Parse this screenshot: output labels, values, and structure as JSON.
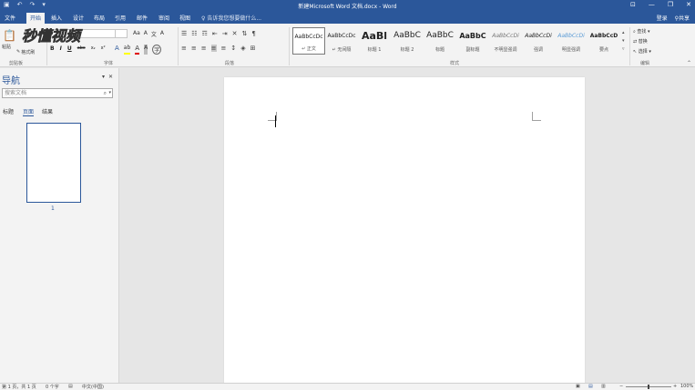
{
  "window": {
    "title": "新建Microsoft Word 文档.docx - Word",
    "qat_icons": [
      "save-icon",
      "undo-icon",
      "redo-icon",
      "customize-icon"
    ],
    "controls": [
      "ribbon-display-icon",
      "minimize-icon",
      "restore-icon",
      "close-icon"
    ]
  },
  "tabs": {
    "items": [
      "文件",
      "开始",
      "插入",
      "设计",
      "布局",
      "引用",
      "邮件",
      "审阅",
      "视图"
    ],
    "active": "开始",
    "tellme": "告诉我您想要做什么...",
    "login": "登录",
    "share": "共享"
  },
  "ribbon": {
    "clipboard": {
      "paste": "粘贴",
      "format_painter": "格式刷",
      "label": "剪贴板"
    },
    "font": {
      "label": "字体",
      "font_name": "",
      "font_size": "",
      "bold": "B",
      "italic": "I",
      "underline": "U",
      "strike": "abc",
      "subscript": "x₂",
      "superscript": "x²",
      "grow": "A",
      "shrink": "A",
      "case": "Aa",
      "clear": "A",
      "phonetic": "文",
      "border": "A",
      "highlight": "ab",
      "font_color": "A",
      "charshade": "A",
      "enclose": "字"
    },
    "paragraph": {
      "label": "段落"
    },
    "styles": {
      "label": "样式",
      "items": [
        {
          "sample": "AaBbCcDc",
          "name": "正文"
        },
        {
          "sample": "AaBbCcDc",
          "name": "无间隔"
        },
        {
          "sample": "AaBl",
          "name": "标题 1"
        },
        {
          "sample": "AaBbC",
          "name": "标题 2"
        },
        {
          "sample": "AaBbC",
          "name": "标题"
        },
        {
          "sample": "AaBbC",
          "name": "副标题"
        },
        {
          "sample": "AaBbCcDi",
          "name": "不明显强调"
        },
        {
          "sample": "AaBbCcDi",
          "name": "强调"
        },
        {
          "sample": "AaBbCcDi",
          "name": "明显强调"
        },
        {
          "sample": "AaBbCcD",
          "name": "要点"
        }
      ]
    },
    "editing": {
      "label": "编辑",
      "find": "查找",
      "replace": "替换",
      "select": "选择"
    }
  },
  "watermark": {
    "text": "秒懂视频"
  },
  "nav": {
    "title": "导航",
    "search_placeholder": "搜索文档",
    "tabs": [
      "标题",
      "页面",
      "结果"
    ],
    "active_tab": "页面",
    "thumb_page_num": "1"
  },
  "status": {
    "page": "第 1 页，共 1 页",
    "words": "0 个字",
    "lang": "中文(中国)",
    "zoom": "100%",
    "zoom_fraction": 0.5
  },
  "colors": {
    "accent": "#2b579a"
  }
}
